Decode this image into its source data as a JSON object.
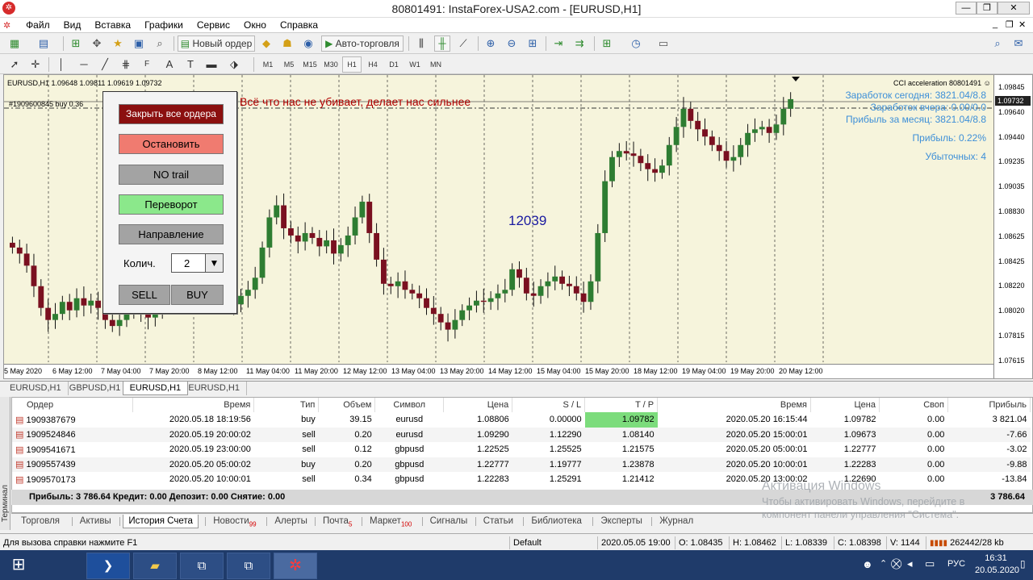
{
  "window": {
    "title": "80801491: InstaForex-USA2.com - [EURUSD,H1]",
    "app_icon": "instaforex-logo-icon"
  },
  "menu": [
    "Файл",
    "Вид",
    "Вставка",
    "Графики",
    "Сервис",
    "Окно",
    "Справка"
  ],
  "toolbar": {
    "new_order": "Новый ордер",
    "auto_trading": "Авто-торговля"
  },
  "timeframes": [
    "M1",
    "M5",
    "M15",
    "M30",
    "H1",
    "H4",
    "D1",
    "W1",
    "MN"
  ],
  "timeframe_active": "H1",
  "drawing_tools": [
    "A",
    "T"
  ],
  "chart": {
    "header": "EURUSD,H1  1.09648 1.09811 1.09619 1.09732",
    "order_line_label": "#1909600845 buy 0.36",
    "motto": "Всё что нас не убивает, делает нас сильнее",
    "center_number": "12039",
    "indicator_label": "CCI acceleration  80801491",
    "stats": [
      "Заработок сегодня: 3821.04/8.8",
      "Заработок вчера: 0.00/0.0",
      "Прибыль за месяц: 3821.04/8.8",
      "Прибыль: 0.22%",
      "Убыточных: 4"
    ],
    "current_price": "1.09732",
    "price_labels": [
      "1.09845",
      "1.09640",
      "1.09440",
      "1.09235",
      "1.09035",
      "1.08830",
      "1.08625",
      "1.08425",
      "1.08220",
      "1.08020",
      "1.07815",
      "1.07615"
    ],
    "time_labels": [
      "5 May 2020",
      "6 May 12:00",
      "7 May 04:00",
      "7 May 20:00",
      "8 May 12:00",
      "11 May 04:00",
      "11 May 20:00",
      "12 May 12:00",
      "13 May 04:00",
      "13 May 20:00",
      "14 May 12:00",
      "15 May 04:00",
      "15 May 20:00",
      "18 May 12:00",
      "19 May 04:00",
      "19 May 20:00",
      "20 May 12:00"
    ],
    "colors": {
      "background": "#f6f4dc",
      "bull": "#2e7d32",
      "bear": "#7a1020",
      "motto": "#b00000",
      "stats": "#3d8fd8",
      "center": "#1a1aa0"
    },
    "closes": [
      1.085,
      1.0845,
      1.0835,
      1.0818,
      1.08,
      1.079,
      1.0795,
      1.0805,
      1.0798,
      1.0808,
      1.0802,
      1.0806,
      1.08,
      1.079,
      1.0785,
      1.079,
      1.08,
      1.081,
      1.0795,
      1.0792,
      1.0796,
      1.0822,
      1.0838,
      1.0842,
      1.084,
      1.0832,
      1.0815,
      1.082,
      1.0832,
      1.0825,
      1.0812,
      1.0803,
      1.081,
      1.0815,
      1.0825,
      1.085,
      1.0875,
      1.0885,
      1.0866,
      1.086,
      1.0855,
      1.0862,
      1.0858,
      1.0851,
      1.0856,
      1.0845,
      1.0852,
      1.086,
      1.0875,
      1.0888,
      1.0862,
      1.084,
      1.082,
      1.0818,
      1.0822,
      1.0815,
      1.0812,
      1.0808,
      1.08,
      1.0795,
      1.0788,
      1.0782,
      1.079,
      1.0798,
      1.0802,
      1.0806,
      1.0805,
      1.0808,
      1.0812,
      1.0815,
      1.0832,
      1.0825,
      1.0812,
      1.081,
      1.0818,
      1.0822,
      1.0826,
      1.082,
      1.0818,
      1.0812,
      1.0805,
      1.0822,
      1.0862,
      1.0905,
      1.0925,
      1.093,
      1.0928,
      1.0926,
      1.092,
      1.0915,
      1.0912,
      1.0918,
      1.0935,
      1.095,
      1.0965,
      1.0955,
      1.0948,
      1.0942,
      1.0935,
      1.093,
      1.0922,
      1.0925,
      1.0935,
      1.0945,
      1.0948,
      1.095,
      1.0945,
      1.0952,
      1.0965,
      1.0973
    ]
  },
  "panel": {
    "close_all": "Закрыть все ордера",
    "stop": "Остановить",
    "no_trail": "NO trail",
    "reverse": "Переворот",
    "direction": "Направление",
    "qty_label": "Колич.",
    "qty_value": "2",
    "sell": "SELL",
    "buy": "BUY"
  },
  "chart_tabs": [
    "EURUSD,H1",
    "GBPUSD,H1",
    "EURUSD,H1",
    "EURUSD,H1"
  ],
  "chart_tab_active": 2,
  "terminal": {
    "side_label": "Терминал",
    "columns": [
      "Ордер",
      "Время",
      "Тип",
      "Объем",
      "Символ",
      "Цена",
      "S / L",
      "T / P",
      "Время",
      "Цена",
      "Своп",
      "Прибыль"
    ],
    "rows": [
      [
        "1909387679",
        "2020.05.18 18:19:56",
        "buy",
        "39.15",
        "eurusd",
        "1.08806",
        "0.00000",
        "1.09782",
        "2020.05.20 16:15:44",
        "1.09782",
        "0.00",
        "3 821.04"
      ],
      [
        "1909524846",
        "2020.05.19 20:00:02",
        "sell",
        "0.20",
        "eurusd",
        "1.09290",
        "1.12290",
        "1.08140",
        "2020.05.20 15:00:01",
        "1.09673",
        "0.00",
        "-7.66"
      ],
      [
        "1909541671",
        "2020.05.19 23:00:00",
        "sell",
        "0.12",
        "gbpusd",
        "1.22525",
        "1.25525",
        "1.21575",
        "2020.05.20 05:00:01",
        "1.22777",
        "0.00",
        "-3.02"
      ],
      [
        "1909557439",
        "2020.05.20 05:00:02",
        "buy",
        "0.20",
        "gbpusd",
        "1.22777",
        "1.19777",
        "1.23878",
        "2020.05.20 10:00:01",
        "1.22283",
        "0.00",
        "-9.88"
      ],
      [
        "1909570173",
        "2020.05.20 10:00:01",
        "sell",
        "0.34",
        "gbpusd",
        "1.22283",
        "1.25291",
        "1.21412",
        "2020.05.20 13:00:02",
        "1.22690",
        "0.00",
        "-13.84"
      ]
    ],
    "summary": "Прибыль: 3 786.64  Кредит: 0.00  Депозит: 0.00  Снятие: 0.00",
    "summary_total": "3 786.64",
    "tabs": [
      {
        "label": "Торговля"
      },
      {
        "label": "Активы"
      },
      {
        "label": "История Счета"
      },
      {
        "label": "Новости",
        "badge": "99"
      },
      {
        "label": "Алерты"
      },
      {
        "label": "Почта",
        "badge": "5"
      },
      {
        "label": "Маркет",
        "badge": "100"
      },
      {
        "label": "Сигналы"
      },
      {
        "label": "Статьи"
      },
      {
        "label": "Библиотека"
      },
      {
        "label": "Эксперты"
      },
      {
        "label": "Журнал"
      }
    ],
    "tab_active": 2
  },
  "watermark": {
    "title": "Активация Windows",
    "line1": "Чтобы активировать Windows, перейдите в",
    "line2": "компонент панели управления \"Система\"."
  },
  "statusbar": {
    "help": "Для вызова справки нажмите F1",
    "profile": "Default",
    "datetime": "2020.05.05 19:00",
    "open": "O: 1.08435",
    "high": "H: 1.08462",
    "low": "L: 1.08339",
    "close": "C: 1.08398",
    "volume": "V: 1144",
    "traffic": "262442/28 kb"
  },
  "taskbar": {
    "lang": "РУС",
    "time": "16:31",
    "date": "20.05.2020"
  }
}
